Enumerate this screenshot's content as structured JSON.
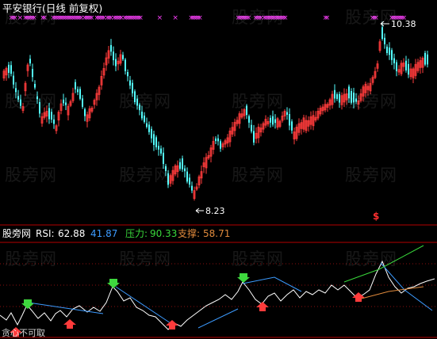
{
  "header": {
    "title": "平安银行(日线 前复权)",
    "title_color": "#ffffff"
  },
  "main_chart": {
    "price_high_label": "10.38",
    "price_low_label": "8.23",
    "up_color": "#ff3b3b",
    "down_color": "#54ffff",
    "signal_marker": "$",
    "top_marker_glyph": "×",
    "top_marker_color": "#ff40ff",
    "top_markers": [
      3,
      4,
      5,
      8,
      11,
      12,
      13,
      14,
      15,
      16,
      21,
      22,
      27,
      28,
      29,
      30,
      31,
      32,
      33,
      34,
      35,
      36,
      37,
      38,
      39,
      40,
      41,
      42,
      43,
      45,
      46,
      47,
      48,
      49,
      52,
      53,
      54,
      55,
      56,
      58,
      59,
      60,
      62,
      63,
      64,
      65,
      66,
      68,
      69,
      70,
      71,
      72,
      73,
      74,
      75,
      76,
      77,
      88,
      97,
      106,
      107,
      108,
      109,
      110,
      111,
      133,
      134,
      135,
      136,
      137,
      138,
      139,
      143,
      144,
      145,
      146,
      148,
      149,
      150,
      151,
      152,
      153,
      154,
      155,
      156,
      157,
      158,
      159,
      160,
      183,
      184,
      210,
      211,
      212,
      221,
      222,
      223,
      224,
      225,
      226,
      227,
      228
    ]
  },
  "indicator": {
    "name": "股旁网",
    "rsi_label": "RSI:",
    "rsi_value": "62.88",
    "rsi2_value": "41.87",
    "pressure_label": "压力:",
    "pressure_value": "90.33",
    "support_label": "支撑:",
    "support_value": "58.71",
    "rsi_line_color": "#ffffff",
    "pressure_line_color": "#3c9bff",
    "support_line_color": "#e08a3c",
    "upper_channel_color": "#39d83b",
    "down_arrow_color": "#3ed83e",
    "up_arrow_color": "#ff3b3b"
  },
  "footer": {
    "partial_text": "贪心不可取"
  },
  "watermark": "股旁网",
  "colors": {
    "background": "#000000",
    "separator": "#b40000",
    "grid_dotted": "#8a1010"
  }
}
